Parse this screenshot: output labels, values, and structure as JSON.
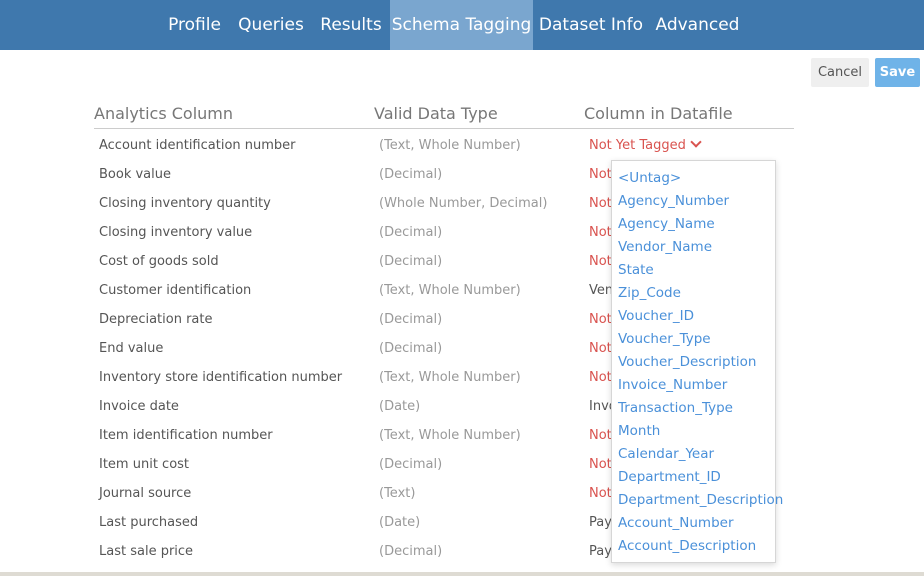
{
  "nav": {
    "tabs": [
      {
        "label": "Profile"
      },
      {
        "label": "Queries"
      },
      {
        "label": "Results"
      },
      {
        "label": "Schema Tagging"
      },
      {
        "label": "Dataset Info"
      },
      {
        "label": "Advanced"
      }
    ],
    "active_tab": "Schema Tagging"
  },
  "actions": {
    "cancel_label": "Cancel",
    "save_label": "Save"
  },
  "table": {
    "headers": [
      "Analytics Column",
      "Valid Data Type",
      "Column in Datafile"
    ],
    "rows": [
      {
        "name": "Account identification number",
        "type": "(Text, Whole Number)",
        "tag": "Not Yet Tagged"
      },
      {
        "name": "Book value",
        "type": "(Decimal)",
        "tag": "Not"
      },
      {
        "name": "Closing inventory quantity",
        "type": "(Whole Number, Decimal)",
        "tag": "Not"
      },
      {
        "name": "Closing inventory value",
        "type": "(Decimal)",
        "tag": "Not"
      },
      {
        "name": "Cost of goods sold",
        "type": "(Decimal)",
        "tag": "Not"
      },
      {
        "name": "Customer identification",
        "type": "(Text, Whole Number)",
        "tag": "Ven"
      },
      {
        "name": "Depreciation rate",
        "type": "(Decimal)",
        "tag": "Not"
      },
      {
        "name": "End value",
        "type": "(Decimal)",
        "tag": "Not"
      },
      {
        "name": "Inventory store identification number",
        "type": "(Text, Whole Number)",
        "tag": "Not"
      },
      {
        "name": "Invoice date",
        "type": "(Date)",
        "tag": "Invo"
      },
      {
        "name": "Item identification number",
        "type": "(Text, Whole Number)",
        "tag": "Not"
      },
      {
        "name": "Item unit cost",
        "type": "(Decimal)",
        "tag": "Not"
      },
      {
        "name": "Journal source",
        "type": "(Text)",
        "tag": "Not"
      },
      {
        "name": "Last purchased",
        "type": "(Date)",
        "tag": "Pay"
      },
      {
        "name": "Last sale price",
        "type": "(Decimal)",
        "tag": "Pay"
      }
    ]
  },
  "dropdown": {
    "options": [
      "<Untag>",
      "Agency_Number",
      "Agency_Name",
      "Vendor_Name",
      "State",
      "Zip_Code",
      "Voucher_ID",
      "Voucher_Type",
      "Voucher_Description",
      "Invoice_Number",
      "Transaction_Type",
      "Month",
      "Calendar_Year",
      "Department_ID",
      "Department_Description",
      "Account_Number",
      "Account_Description"
    ]
  },
  "colors": {
    "nav_bg": "#3f78ad",
    "nav_active": "#7aa6cf",
    "save_button": "#6fb3e8",
    "untagged_red": "#d9534f",
    "link_blue": "#4a90d9"
  },
  "icons": {
    "tag_dropdown": "chevron-down-icon"
  }
}
